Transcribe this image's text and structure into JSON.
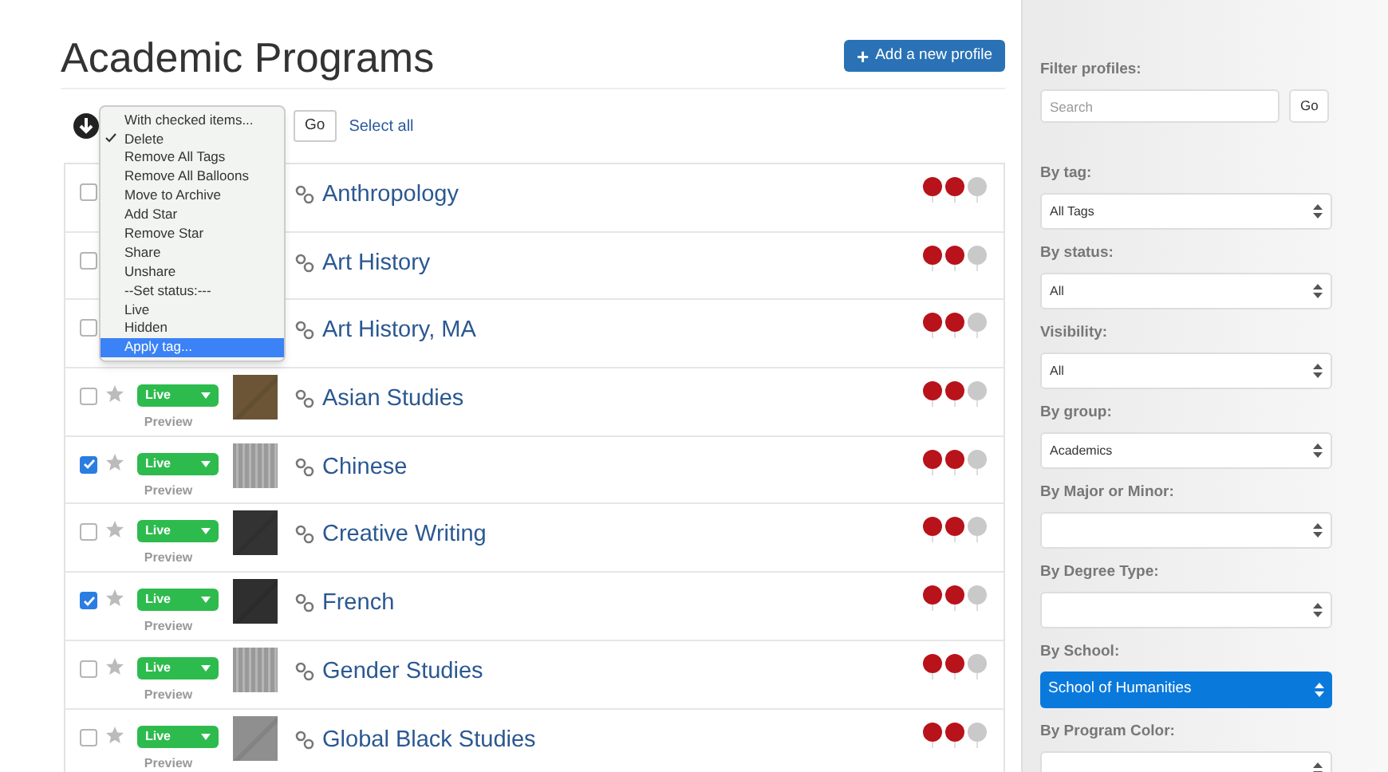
{
  "title": "Academic Programs",
  "add_button": {
    "icon": "+",
    "label": "Add a new profile"
  },
  "bulk_actions": {
    "go": "Go",
    "select_all": "Select all",
    "menu": [
      {
        "label": "With checked items...",
        "checked": false,
        "selected": false
      },
      {
        "label": "Delete",
        "checked": true,
        "selected": false
      },
      {
        "label": "Remove All Tags",
        "checked": false,
        "selected": false
      },
      {
        "label": "Remove All Balloons",
        "checked": false,
        "selected": false
      },
      {
        "label": "Move to Archive",
        "checked": false,
        "selected": false
      },
      {
        "label": "Add Star",
        "checked": false,
        "selected": false
      },
      {
        "label": "Remove Star",
        "checked": false,
        "selected": false
      },
      {
        "label": "Share",
        "checked": false,
        "selected": false
      },
      {
        "label": "Unshare",
        "checked": false,
        "selected": false
      },
      {
        "label": "--Set status:---",
        "checked": false,
        "selected": false
      },
      {
        "label": "Live",
        "checked": false,
        "selected": false
      },
      {
        "label": "Hidden",
        "checked": false,
        "selected": false
      },
      {
        "label": "Apply tag...",
        "checked": false,
        "selected": true
      }
    ]
  },
  "programs": [
    {
      "name": "Anthropology",
      "checked": false,
      "stars": 2
    },
    {
      "name": "Art History",
      "checked": false,
      "stars": 2
    },
    {
      "name": "Art History, MA",
      "checked": false,
      "stars": 2
    },
    {
      "name": "Asian Studies",
      "checked": false,
      "stars": 2,
      "status": "Live",
      "preview": "Preview",
      "thumbnail": {
        "color": "#6b5536",
        "striped": false
      }
    },
    {
      "name": "Chinese",
      "checked": true,
      "stars": 2,
      "status": "Live",
      "preview": "Preview",
      "thumbnail": {
        "color": "#9a9a9a",
        "striped": true
      }
    },
    {
      "name": "Creative Writing",
      "checked": false,
      "stars": 2,
      "status": "Live",
      "preview": "Preview",
      "thumbnail": {
        "color": "#333333",
        "striped": false
      }
    },
    {
      "name": "French",
      "checked": true,
      "stars": 2,
      "status": "Live",
      "preview": "Preview",
      "thumbnail": {
        "color": "#2f2f2f",
        "striped": false
      }
    },
    {
      "name": "Gender Studies",
      "checked": false,
      "stars": 2,
      "status": "Live",
      "preview": "Preview",
      "thumbnail": {
        "color": "#999999",
        "striped": true
      }
    },
    {
      "name": "Global Black Studies",
      "checked": false,
      "stars": 2,
      "status": "Live",
      "preview": "Preview",
      "thumbnail": {
        "color": "#8f8f8f",
        "striped": false
      }
    }
  ],
  "sidebar": {
    "filters": [
      {
        "kind": "search",
        "label": "Filter profiles:",
        "placeholder": "Search",
        "button": "Go"
      },
      {
        "kind": "select",
        "label": "By tag:",
        "value": "All Tags",
        "highlighted": false
      },
      {
        "kind": "select",
        "label": "By status:",
        "value": "All",
        "highlighted": false
      },
      {
        "kind": "select",
        "label": "Visibility:",
        "value": "All",
        "highlighted": false
      },
      {
        "kind": "select",
        "label": "By group:",
        "value": "Academics",
        "highlighted": false
      },
      {
        "kind": "select",
        "label": "By Major or Minor:",
        "highlighted": false
      },
      {
        "kind": "select",
        "label": "By Degree Type:",
        "highlighted": false
      },
      {
        "kind": "select",
        "label": "By School:",
        "value": "School of Humanities",
        "highlighted": true
      },
      {
        "kind": "select",
        "label": "By Program Color:",
        "highlighted": false
      }
    ]
  }
}
